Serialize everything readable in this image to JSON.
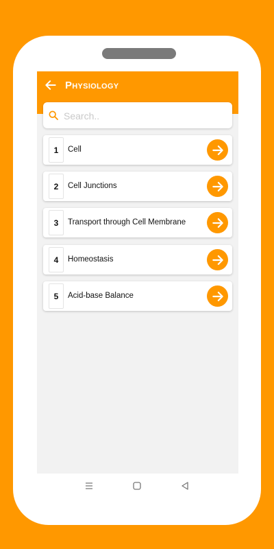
{
  "app_bar": {
    "title": "Physiology",
    "back_icon": "arrow-left-icon"
  },
  "search": {
    "placeholder": "Search..",
    "value": "",
    "icon": "search-icon"
  },
  "topics": [
    {
      "number": "1",
      "label": "Cell"
    },
    {
      "number": "2",
      "label": "Cell Junctions"
    },
    {
      "number": "3",
      "label": "Transport through Cell Membrane"
    },
    {
      "number": "4",
      "label": "Homeostasis"
    },
    {
      "number": "5",
      "label": "Acid-base Balance"
    }
  ],
  "nav_bar": {
    "icons": [
      "menu-icon",
      "home-square-icon",
      "back-triangle-icon"
    ]
  },
  "colors": {
    "accent": "#FF9800",
    "background": "#F2F2F2"
  }
}
